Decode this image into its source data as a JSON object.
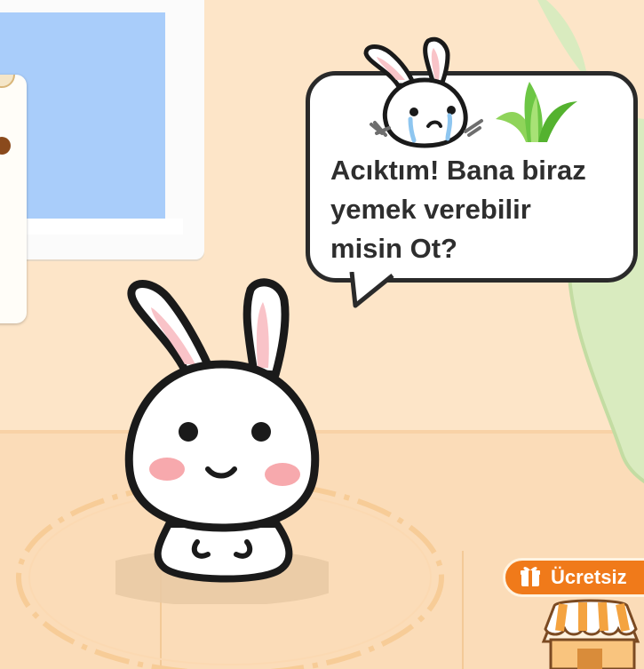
{
  "speech_bubble": {
    "text": "Acıktım! Bana biraz\nyemek verebilir\nmisin Ot?"
  },
  "icons": {
    "mini_bunny": "sad-bunny-with-fork-icon",
    "grass": "grass-icon",
    "gift": "gift-icon",
    "shop": "shop-icon"
  },
  "badge": {
    "label": "Ücretsiz"
  },
  "colors": {
    "wall": "#fde5c8",
    "floor": "#fbdcb8",
    "window_glass": "#a9cdfa",
    "curtain": "#d9ebbf",
    "badge": "#f07a1a",
    "grass": "#6cc644"
  }
}
